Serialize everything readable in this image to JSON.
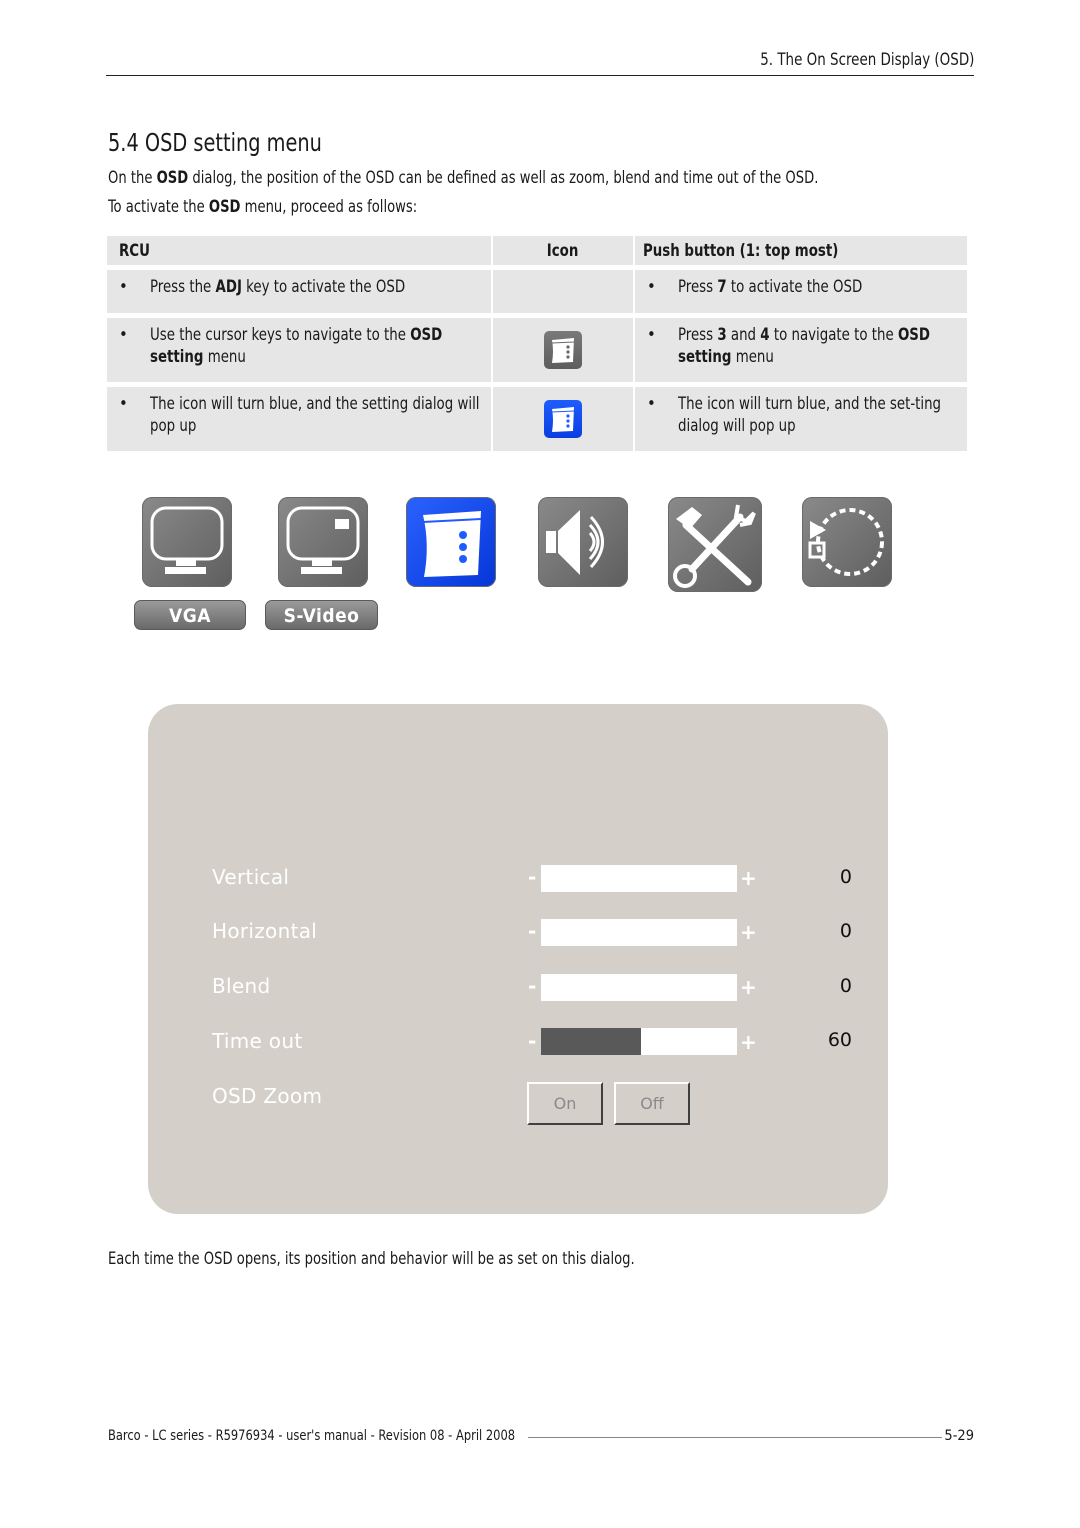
{
  "running_head": "5. The On Screen Display (OSD)",
  "section": {
    "title": "5.4 OSD setting menu",
    "intro_line1": {
      "pre": "On the ",
      "bold": "OSD",
      "post": " dialog, the position of the OSD can be defined as well as zoom, blend and time out of the OSD."
    },
    "intro_line2": {
      "pre": "To activate the ",
      "bold": "OSD",
      "post": " menu, proceed as follows:"
    }
  },
  "table": {
    "headers": {
      "rcu": "RCU",
      "icon": "Icon",
      "push": "Push button (1: top most)"
    },
    "rows": [
      {
        "rcu": {
          "a": "Press the ",
          "b": "ADJ",
          "c": " key to activate the OSD",
          "d": "",
          "e": ""
        },
        "icon": "none",
        "push": {
          "a": "Press ",
          "b": "7",
          "c": " to activate the OSD",
          "d": "",
          "e": ""
        }
      },
      {
        "rcu": {
          "a": "Use the cursor keys to navigate to the ",
          "b": "OSD setting",
          "c": " menu"
        },
        "icon": "osd-setting-icon-gray",
        "push": {
          "a": "Press ",
          "b1": "3",
          "m": " and ",
          "b2": "4",
          "c": " to navigate to the ",
          "b3": "OSD setting",
          "d": " menu"
        }
      },
      {
        "rcu": {
          "text": "The icon will turn blue, and the setting dialog will pop up"
        },
        "icon": "osd-setting-icon-blue",
        "push": {
          "text": "The icon will turn blue, and the set-ting dialog will pop up"
        }
      }
    ],
    "bullet": "•"
  },
  "menu_icons": [
    {
      "name": "vga-source-icon",
      "state": "inactive"
    },
    {
      "name": "svideo-source-icon",
      "state": "inactive"
    },
    {
      "name": "osd-setting-icon",
      "state": "selected"
    },
    {
      "name": "audio-icon",
      "state": "inactive"
    },
    {
      "name": "tools-icon",
      "state": "inactive"
    },
    {
      "name": "recall-reset-icon",
      "state": "inactive"
    }
  ],
  "source_buttons": {
    "vga": "VGA",
    "svideo": "S-Video"
  },
  "osd_dialog": {
    "minus": "-",
    "plus": "+",
    "settings": [
      {
        "label": "Vertical",
        "value": "0",
        "level": 0
      },
      {
        "label": "Horizontal",
        "value": "0",
        "level": 0
      },
      {
        "label": "Blend",
        "value": "0",
        "level": 0
      },
      {
        "label": "Time out",
        "value": "60",
        "level": 0.5
      }
    ],
    "zoom": {
      "label": "OSD Zoom",
      "on": "On",
      "off": "Off"
    }
  },
  "closing_text": "Each time the OSD opens, its position and behavior will be as set on this dialog.",
  "footer": {
    "left": "Barco - LC series - R5976934 - user's manual - Revision 08 - April 2008",
    "page": "5-29"
  }
}
